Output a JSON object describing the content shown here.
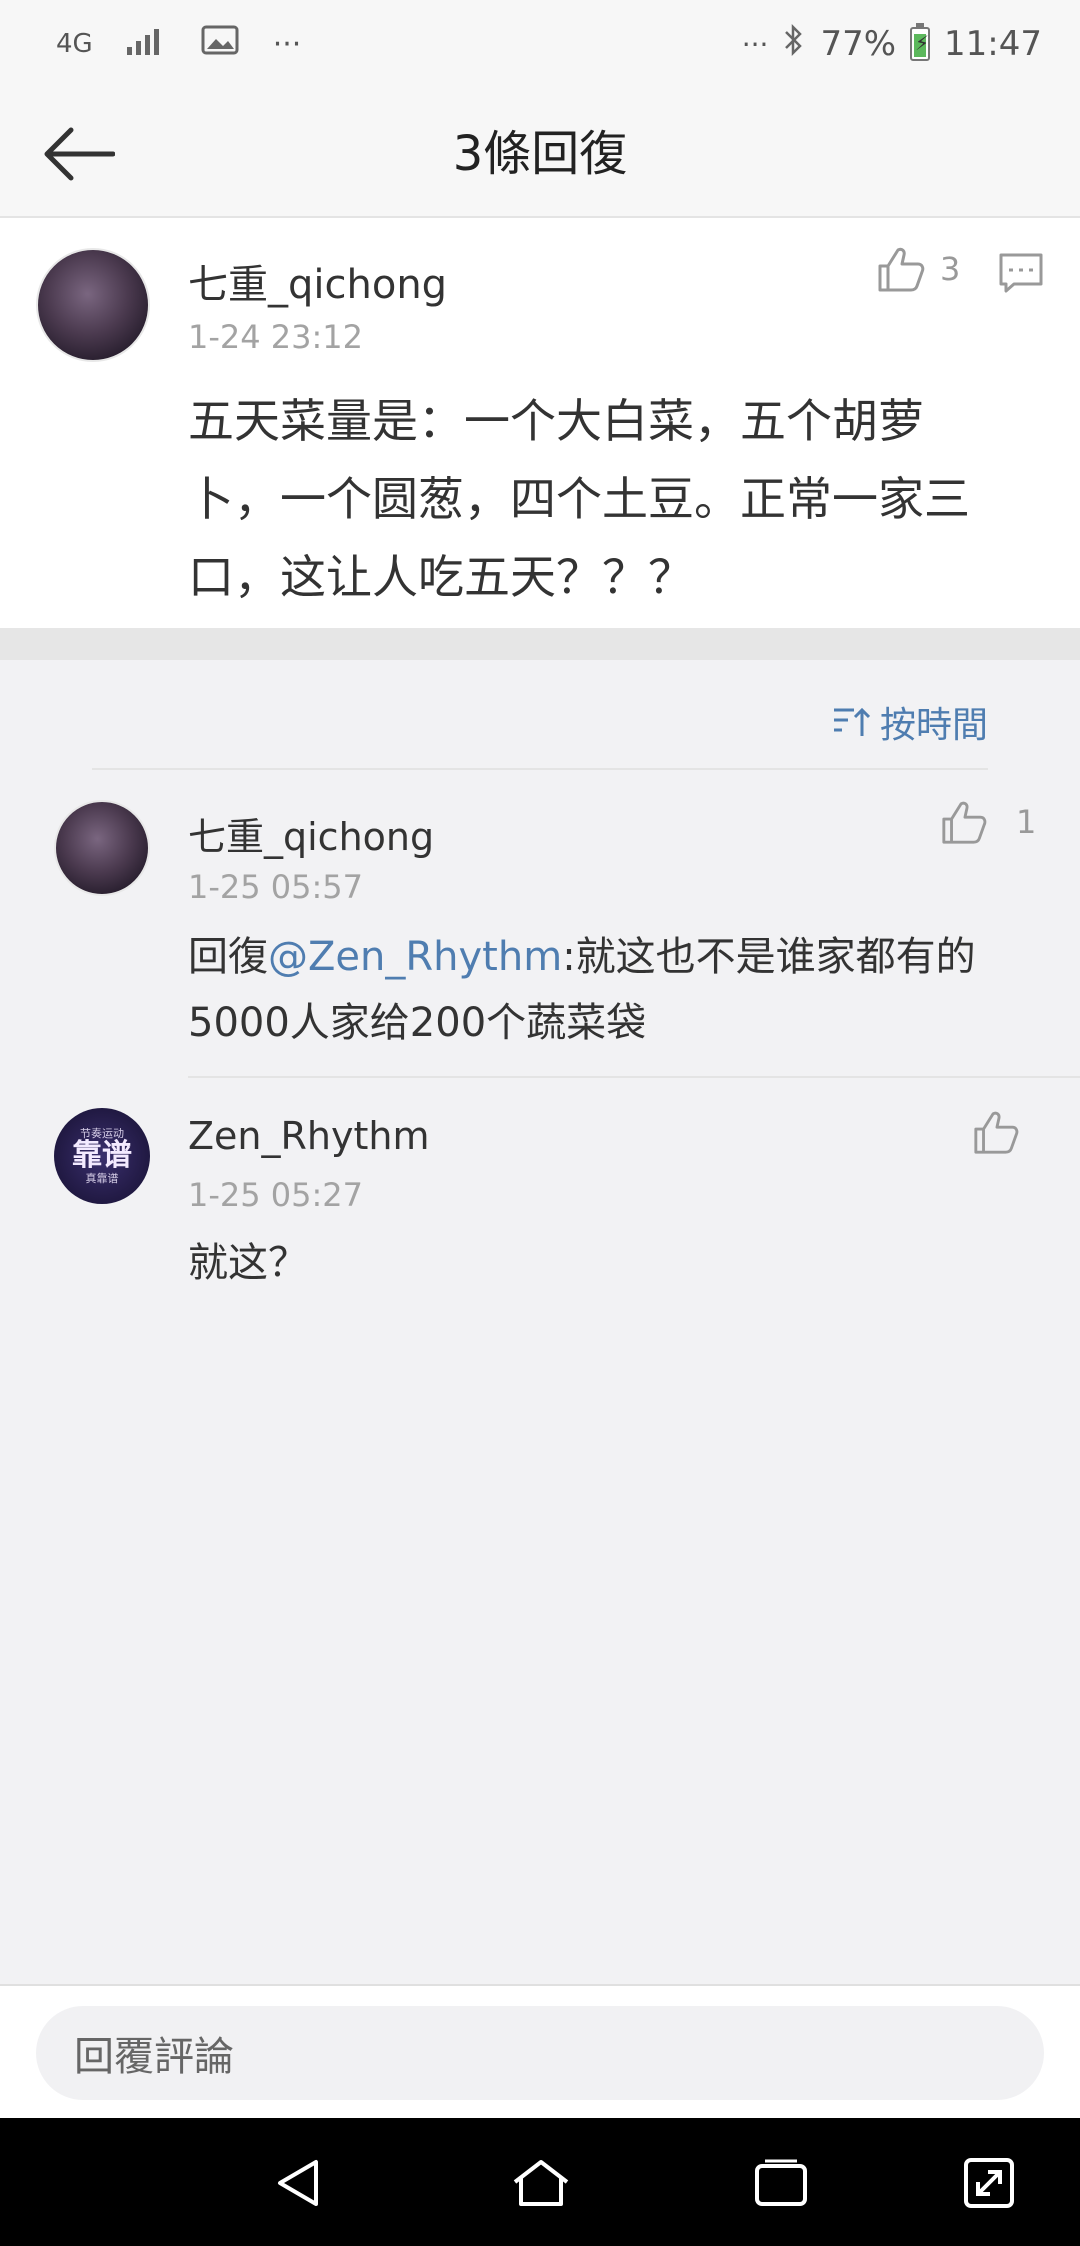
{
  "status_bar": {
    "network": "4G",
    "more": "···",
    "more_right": "···",
    "battery": "77%",
    "time": "11:47",
    "battery_level": 0.77
  },
  "header": {
    "title": "3條回復"
  },
  "main_comment": {
    "username": "七重_qichong",
    "time": "1-24 23:12",
    "like_count": "3",
    "text_lines": [
      "五天菜量是：一个大白菜，五个胡萝",
      "卜，一个圆葱，四个土豆。正常一家三",
      "口，这让人吃五天？？？"
    ]
  },
  "sort": {
    "label": "按時間"
  },
  "replies": [
    {
      "username": "七重_qichong",
      "time": "1-25 05:57",
      "like_count": "1",
      "prefix": "回復",
      "mention": "@Zen_Rhythm",
      "text_line1": ":就这也不是谁家都有的",
      "text_line2": "5000人家给200个蔬菜袋"
    },
    {
      "username": "Zen_Rhythm",
      "time": "1-25 05:27",
      "text": "就这？",
      "avatar_text": "靠谱",
      "avatar_top": "节奏运动",
      "avatar_bottom": "真靠谱"
    }
  ],
  "composer": {
    "placeholder": "回覆評論"
  }
}
